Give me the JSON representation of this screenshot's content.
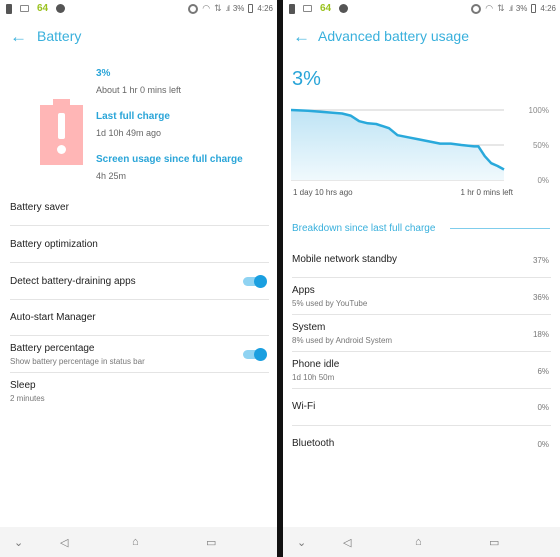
{
  "status_bar": {
    "left_number": "64",
    "battery_text": "3%",
    "time": "4:26",
    "icons": [
      "battery-alert-icon",
      "image-icon",
      "circle-icon",
      "sync-icon",
      "wifi-icon",
      "data-icon",
      "signal-icon",
      "battery-icon"
    ]
  },
  "left_screen": {
    "title": "Battery",
    "back_icon": "arrow-left-icon",
    "battery_icon": "battery-alert-icon",
    "level": "3%",
    "time_left": "About 1 hr 0 mins left",
    "last_full_charge_label": "Last full charge",
    "last_full_charge_value": "1d 10h 49m ago",
    "screen_usage_label": "Screen usage since full charge",
    "screen_usage_value": "4h 25m",
    "items": [
      {
        "title": "Battery saver"
      },
      {
        "title": "Battery optimization"
      },
      {
        "title": "Detect battery-draining apps",
        "toggle": true
      },
      {
        "title": "Auto-start Manager"
      },
      {
        "title": "Battery percentage",
        "subtitle": "Show battery percentage in status bar",
        "toggle": true
      },
      {
        "title": "Sleep",
        "subtitle": "2 minutes"
      }
    ]
  },
  "right_screen": {
    "title": "Advanced battery usage",
    "back_icon": "arrow-left-icon",
    "level": "3%",
    "chart": {
      "y_labels": [
        "100%",
        "50%",
        "0%"
      ],
      "x_start_label": "1 day 10 hrs ago",
      "x_end_label": "1 hr 0 mins left",
      "line_color": "#29a9db",
      "points": [
        [
          0,
          100
        ],
        [
          0.08,
          99
        ],
        [
          0.16,
          97
        ],
        [
          0.24,
          95
        ],
        [
          0.28,
          92
        ],
        [
          0.32,
          84
        ],
        [
          0.36,
          81
        ],
        [
          0.4,
          80
        ],
        [
          0.43,
          77
        ],
        [
          0.46,
          74
        ],
        [
          0.5,
          64
        ],
        [
          0.55,
          61
        ],
        [
          0.6,
          58
        ],
        [
          0.65,
          55
        ],
        [
          0.7,
          52
        ],
        [
          0.75,
          52
        ],
        [
          0.8,
          50
        ],
        [
          0.86,
          48
        ],
        [
          0.88,
          48
        ],
        [
          0.91,
          34
        ],
        [
          0.94,
          24
        ],
        [
          0.97,
          20
        ],
        [
          1.0,
          15
        ]
      ]
    },
    "section_header": "Breakdown since last full charge",
    "items": [
      {
        "title": "Mobile network standby",
        "percent": "37%"
      },
      {
        "title": "Apps",
        "subtitle": "5% used by YouTube",
        "percent": "36%"
      },
      {
        "title": "System",
        "subtitle": "8% used by Android System",
        "percent": "18%"
      },
      {
        "title": "Phone idle",
        "subtitle": "1d 10h 50m",
        "percent": "6%"
      },
      {
        "title": "Wi-Fi",
        "percent": "0%"
      },
      {
        "title": "Bluetooth",
        "percent": "0%"
      }
    ]
  },
  "nav_bar": {
    "icons": [
      "chevron-down-icon",
      "back-triangle-icon",
      "home-icon",
      "recents-icon"
    ],
    "glyphs": [
      "⌄",
      "◁",
      "⌂",
      "▭"
    ]
  }
}
